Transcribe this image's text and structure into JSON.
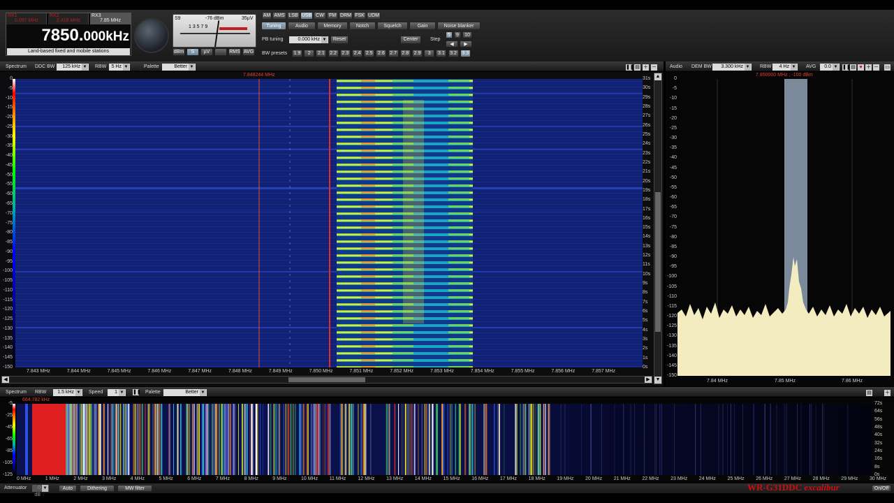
{
  "top": {
    "rx_labels": [
      "RX1",
      "RX2",
      "RX3"
    ],
    "rx_freqs": [
      "0.097 MHz",
      "2.418 MHz",
      "7.85 MHz"
    ],
    "frequency": "7850.000kHz",
    "frequency_main": "7850.",
    "frequency_rest": "000kHz",
    "description": "Land-based fixed and mobile stations",
    "smeter": {
      "left_label": "S9",
      "dbm": "-76 dBm",
      "uv": "35µV",
      "scale": "1 3 5 7 9",
      "units": [
        "dBm",
        "S",
        "µV"
      ],
      "buttons": [
        "RMS",
        "AVG"
      ]
    },
    "modes": [
      "AM",
      "AMS",
      "LSB",
      "USB",
      "CW",
      "FM",
      "DRM",
      "FSK",
      "UDM"
    ],
    "active_mode": "USB",
    "tabs": [
      "Tuning",
      "Audio",
      "Memory",
      "Notch",
      "Squelch",
      "Gain",
      "Noise blanker"
    ],
    "pb_tuning_label": "PB tuning",
    "pb_tuning_value": "0.000 kHz",
    "reset_label": "Reset",
    "center_label": "Center",
    "step_label": "Step",
    "step_values": [
      "5",
      "9",
      "10"
    ],
    "bw_presets_label": "BW presets",
    "bw_presets": [
      "1.9",
      "2",
      "2.1",
      "2.2",
      "2.3",
      "2.4",
      "2.5",
      "2.6",
      "2.7",
      "2.8",
      "2.9",
      "3",
      "3.1",
      "3.2",
      "3.3"
    ]
  },
  "spectrum": {
    "label": "Spectrum",
    "ddc_bw_label": "DDC BW",
    "ddc_bw_value": "125 kHz",
    "rbw_label": "RBW",
    "rbw_value": "5 Hz",
    "palette_label": "Palette",
    "palette_value": "Better",
    "marker_freq": "7.848244 MHz",
    "y_ticks": [
      "0",
      "-5",
      "-10",
      "-15",
      "-20",
      "-25",
      "-30",
      "-35",
      "-40",
      "-45",
      "-50",
      "-55",
      "-60",
      "-65",
      "-70",
      "-75",
      "-80",
      "-85",
      "-90",
      "-95",
      "-100",
      "-105",
      "-110",
      "-115",
      "-120",
      "-125",
      "-130",
      "-135",
      "-140",
      "-145",
      "-150"
    ],
    "time_ticks": [
      "31s",
      "30s",
      "29s",
      "28s",
      "27s",
      "26s",
      "25s",
      "24s",
      "23s",
      "22s",
      "21s",
      "20s",
      "19s",
      "18s",
      "17s",
      "16s",
      "15s",
      "14s",
      "13s",
      "12s",
      "11s",
      "10s",
      "9s",
      "8s",
      "7s",
      "6s",
      "5s",
      "4s",
      "3s",
      "2s",
      "1s",
      "0s"
    ],
    "x_ticks": [
      "7.843 MHz",
      "7.844 MHz",
      "7.845 MHz",
      "7.846 MHz",
      "7.847 MHz",
      "7.848 MHz",
      "7.849 MHz",
      "7.850 MHz",
      "7.851 MHz",
      "7.852 MHz",
      "7.853 MHz",
      "7.854 MHz",
      "7.855 MHz",
      "7.856 MHz",
      "7.857 MHz"
    ]
  },
  "audio": {
    "label": "Audio",
    "dem_bw_label": "DEM BW",
    "dem_bw_value": "3.300 kHz",
    "rbw_label": "RBW",
    "rbw_value": "4 Hz",
    "avg_label": "AVG",
    "avg_value": "0.0 s",
    "marker": "7.850000 MHz ; -100 dBm",
    "y_ticks": [
      "0",
      "-5",
      "-10",
      "-15",
      "-20",
      "-25",
      "-30",
      "-35",
      "-40",
      "-45",
      "-50",
      "-55",
      "-60",
      "-65",
      "-70",
      "-75",
      "-80",
      "-85",
      "-90",
      "-95",
      "-100",
      "-105",
      "-110",
      "-115",
      "-120",
      "-125",
      "-130",
      "-135",
      "-140",
      "-145",
      "-150"
    ],
    "x_ticks": [
      "7.84 MHz",
      "7.85 MHz",
      "7.86 MHz"
    ]
  },
  "wide": {
    "label": "Spectrum",
    "rbw_label": "RBW",
    "rbw_value": "1.5 kHz",
    "speed_label": "Speed",
    "speed_value": "1",
    "palette_label": "Palette",
    "palette_value": "Better",
    "marker_freq": "664.782 kHz",
    "y_ticks": [
      "-5",
      "-25",
      "-45",
      "-65",
      "-85",
      "-105",
      "-125"
    ],
    "time_ticks": [
      "72s",
      "64s",
      "56s",
      "48s",
      "40s",
      "32s",
      "24s",
      "16s",
      "8s",
      "0s"
    ],
    "x_ticks": [
      "0 MHz",
      "1 MHz",
      "2 MHz",
      "3 MHz",
      "4 MHz",
      "5 MHz",
      "6 MHz",
      "7 MHz",
      "8 MHz",
      "9 MHz",
      "10 MHz",
      "11 MHz",
      "12 MHz",
      "13 MHz",
      "14 MHz",
      "15 MHz",
      "16 MHz",
      "17 MHz",
      "18 MHz",
      "19 MHz",
      "20 MHz",
      "21 MHz",
      "22 MHz",
      "23 MHz",
      "24 MHz",
      "25 MHz",
      "26 MHz",
      "27 MHz",
      "28 MHz",
      "29 MHz",
      "30 MHz"
    ]
  },
  "bottom": {
    "attenuator_label": "Attenuator",
    "attenuator_value": "0 dB",
    "buttons": [
      "Auto",
      "Dithering",
      "MW filter"
    ],
    "brand_model": "WR-G31DDC",
    "brand_name": "excalibur",
    "onoff": "On/Off"
  },
  "colors": {
    "waterfall_bg": "#101e6e",
    "signal_hot": "#f0e020",
    "marker_red": "#e03020",
    "audio_band": "#8fa2b5",
    "audio_trace": "#f2ecc0",
    "brand_red": "#d01010"
  }
}
